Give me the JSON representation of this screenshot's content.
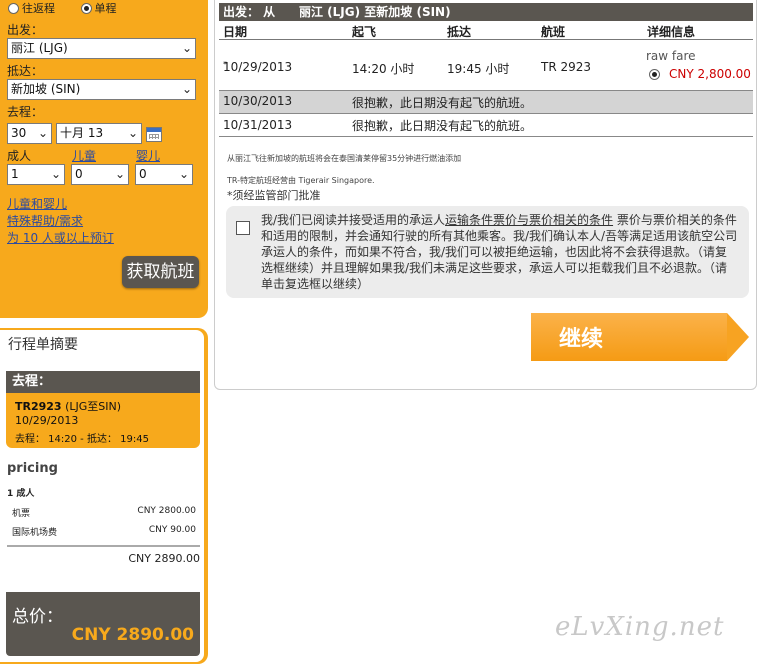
{
  "search": {
    "trip_oneway_label": "往返程",
    "trip_single_label": "单程",
    "depart_label": "出发：",
    "depart_value": "丽江 (LJG)",
    "arrive_label": "抵达：",
    "arrive_value": "新加坡 (SIN)",
    "outbound_label": "去程：",
    "day_value": "30",
    "month_value": "十月 13",
    "adult_label": "成人",
    "child_label": "儿童",
    "infant_label": "婴儿",
    "adult_value": "1",
    "child_value": "0",
    "infant_value": "0",
    "link_kids": "儿童和婴儿",
    "link_special": "特殊帮助/需求",
    "link_group": "为 10 人或以上预订",
    "search_button": "获取航班"
  },
  "summary": {
    "title": "行程单摘要",
    "leg_header": "去程：",
    "flight_no": "TR2923",
    "flight_route": " (LJG至SIN)",
    "date": "10/29/2013",
    "time_line": "去程：  14:20 - 抵达：  19:45",
    "pricing_title": "pricing",
    "pax_line": "1  成人",
    "fare_label": "机票",
    "fare_value": "CNY 2800.00",
    "tax_label": "国际机场费",
    "tax_value": "CNY 90.00",
    "subtotal": "CNY 2890.00",
    "total_label": "总价：",
    "total_value": "CNY  2890.00"
  },
  "main": {
    "route_prefix": "出发：  从",
    "route_text": "丽江 (LJG) 至新加坡 (SIN)",
    "col_date": "日期",
    "col_depart": "起飞",
    "col_arrive": "抵达",
    "col_flight": "航班",
    "col_details": "详细信息",
    "flight_row": {
      "date": "10/29/2013",
      "date_mark": "*",
      "depart": "14:20 小时",
      "arrive": "19:45 小时",
      "flight": "TR 2923",
      "fare_type": "raw fare",
      "price": "CNY 2,800.00"
    },
    "row2_date": "10/30/2013",
    "row2_msg": "很抱歉，此日期没有起飞的航班。",
    "row3_date": "10/31/2013",
    "row3_msg": "很抱歉，此日期没有起飞的航班。",
    "note1": "从丽江飞往新加坡的航班将会在泰国清莱停留35分钟进行燃油添加",
    "note2": "TR-特定航班经营由 Tigerair Singapore.",
    "note3": "*须经监管部门批准",
    "terms_pre": "我/我们已阅读并接受适用的承运人",
    "terms_link": "运输条件票价与票价相关的条件",
    "terms_post": " 票价与票价相关的条件和适用的限制，并会通知行驶的所有其他乘客。我/我们确认本人/吾等满足适用该航空公司承运人的条件，而如果不符合，我/我们可以被拒绝运输，也因此将不会获得退款。（请复选框继续）并且理解如果我/我们未满足这些要求，承运人可以拒载我们且不必退款。（请单击复选框以继续）",
    "continue_label": "继续"
  },
  "watermark": "eLvXing.net",
  "colors": {
    "accent": "#f7a91c",
    "dark": "#5a5650",
    "price": "#cc0000"
  }
}
